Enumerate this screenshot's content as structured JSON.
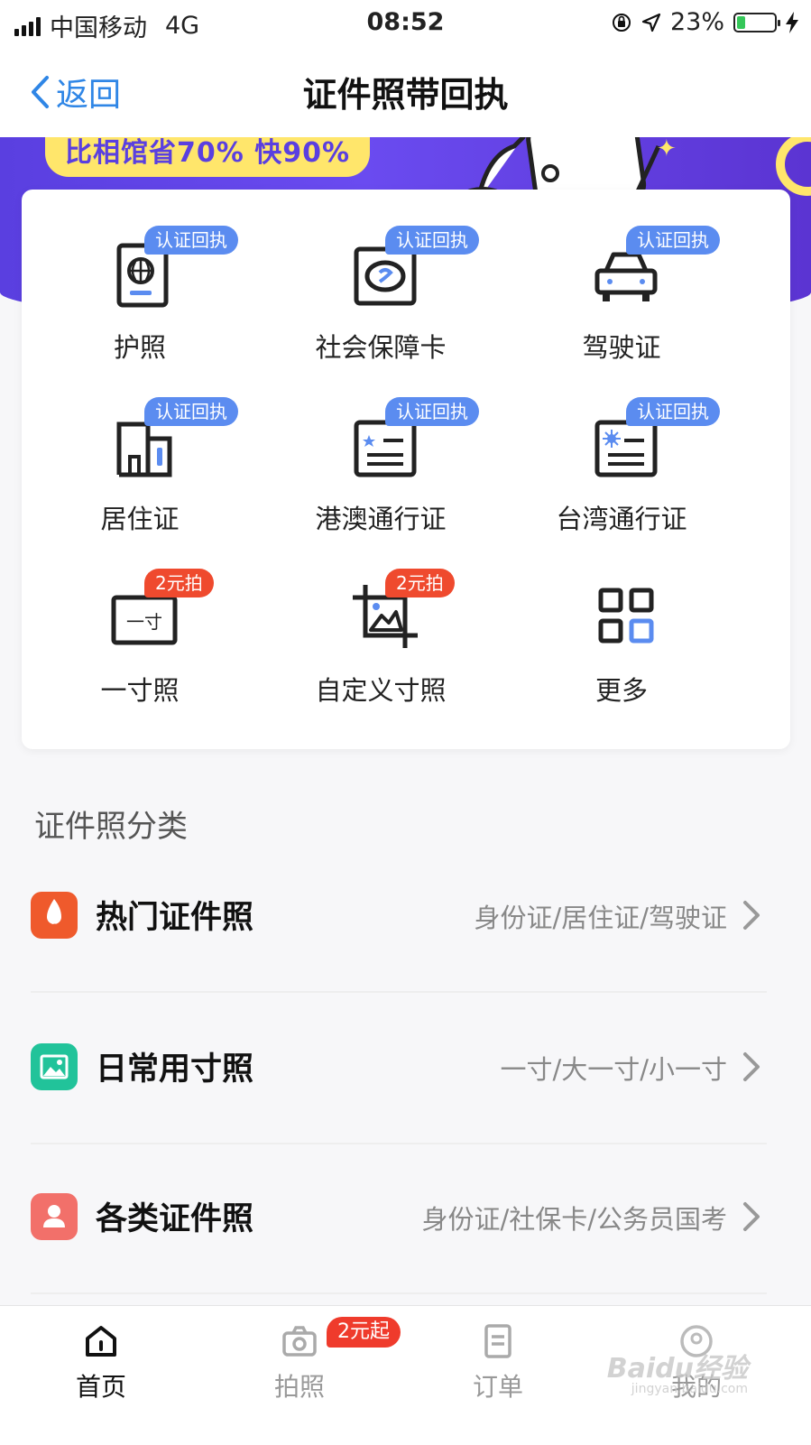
{
  "status_bar": {
    "carrier": "中国移动",
    "network": "4G",
    "time": "08:52",
    "battery": "23%",
    "battery_level": 0.23
  },
  "nav": {
    "back_label": "返回",
    "title": "证件照带回执"
  },
  "banner": {
    "slogan": "比相馆省70% 快90%"
  },
  "services": [
    {
      "label": "护照",
      "tag": "认证回执",
      "tag_color": "#5b8cf0",
      "icon": "passport-icon"
    },
    {
      "label": "社会保障卡",
      "tag": "认证回执",
      "tag_color": "#5b8cf0",
      "icon": "social-security-card-icon"
    },
    {
      "label": "驾驶证",
      "tag": "认证回执",
      "tag_color": "#5b8cf0",
      "icon": "car-icon"
    },
    {
      "label": "居住证",
      "tag": "认证回执",
      "tag_color": "#5b8cf0",
      "icon": "building-icon"
    },
    {
      "label": "港澳通行证",
      "tag": "认证回执",
      "tag_color": "#5b8cf0",
      "icon": "hk-macau-permit-icon"
    },
    {
      "label": "台湾通行证",
      "tag": "认证回执",
      "tag_color": "#5b8cf0",
      "icon": "taiwan-permit-icon"
    },
    {
      "label": "一寸照",
      "tag": "2元拍",
      "tag_color": "#ef4a2e",
      "icon": "one-inch-photo-icon"
    },
    {
      "label": "自定义寸照",
      "tag": "2元拍",
      "tag_color": "#ef4a2e",
      "icon": "custom-crop-icon"
    },
    {
      "label": "更多",
      "tag": "",
      "icon": "grid-icon"
    }
  ],
  "section_title": "证件照分类",
  "categories": [
    {
      "title": "热门证件照",
      "subtitle": "身份证/居住证/驾驶证",
      "icon": "hot-fire-icon",
      "icon_color": "#ef5a2c"
    },
    {
      "title": "日常用寸照",
      "subtitle": "一寸/大一寸/小一寸",
      "icon": "image-icon",
      "icon_color": "#21c39a"
    },
    {
      "title": "各类证件照",
      "subtitle": "身份证/社保卡/公务员国考",
      "icon": "person-icon",
      "icon_color": "#f2706a"
    }
  ],
  "tabs": [
    {
      "label": "首页",
      "icon": "home-icon",
      "active": true
    },
    {
      "label": "拍照",
      "icon": "camera-icon",
      "badge": "2元起"
    },
    {
      "label": "订单",
      "icon": "order-icon"
    },
    {
      "label": "我的",
      "icon": "profile-icon"
    }
  ],
  "watermark": {
    "text": "Baidu经验",
    "sub": "jingyan.baidu.com"
  },
  "colors": {
    "accent": "#2f86e6",
    "banner": "#5a3fe0",
    "tag_blue": "#5b8cf0",
    "tag_red": "#ef4a2e"
  }
}
